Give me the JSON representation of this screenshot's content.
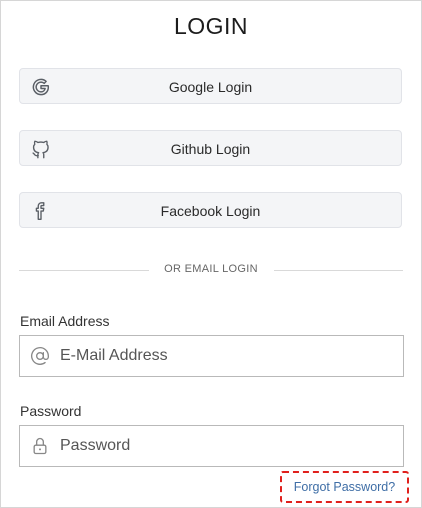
{
  "title": "LOGIN",
  "social_buttons": [
    {
      "label": "Google Login",
      "icon": "google-icon"
    },
    {
      "label": "Github Login",
      "icon": "github-icon"
    },
    {
      "label": "Facebook Login",
      "icon": "facebook-icon"
    }
  ],
  "divider_text": "OR EMAIL LOGIN",
  "email": {
    "label": "Email Address",
    "placeholder": "E-Mail Address",
    "value": "",
    "icon": "at-sign-icon"
  },
  "password": {
    "label": "Password",
    "placeholder": "Password",
    "value": "",
    "icon": "lock-icon"
  },
  "forgot_link": "Forgot Password?",
  "colors": {
    "button_bg": "#f4f5f7",
    "link": "#3f6ea6",
    "highlight_border": "#e0201c"
  }
}
